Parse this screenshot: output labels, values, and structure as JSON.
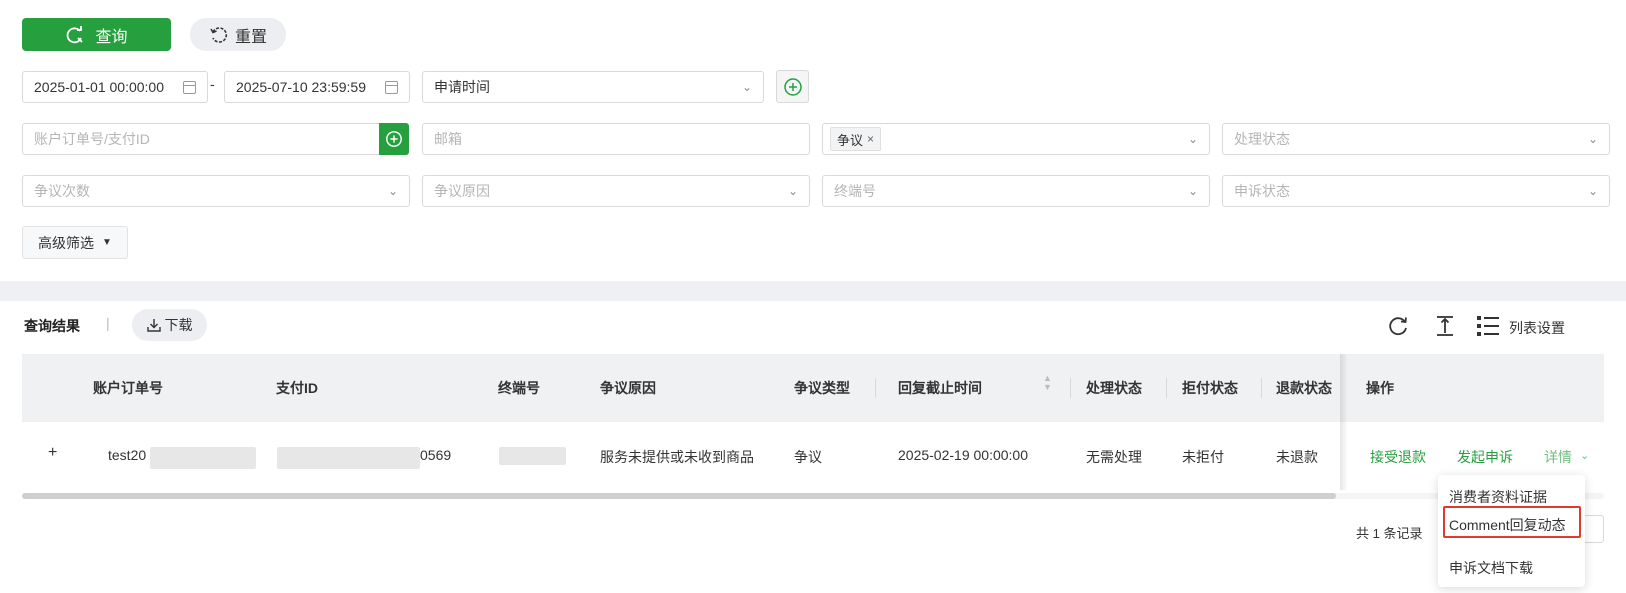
{
  "toolbar": {
    "query_label": "查询",
    "reset_label": "重置"
  },
  "filters": {
    "date_start": "2025-01-01 00:00:00",
    "date_separator": "-",
    "date_end": "2025-07-10 23:59:59",
    "date_type": "申请时间",
    "order_placeholder": "账户订单号/支付ID",
    "email_placeholder": "邮箱",
    "type_tag": "争议",
    "status_placeholder": "处理状态",
    "count_placeholder": "争议次数",
    "reason_placeholder": "争议原因",
    "terminal_placeholder": "终端号",
    "appeal_placeholder": "申诉状态",
    "advanced_label": "高级筛选"
  },
  "results": {
    "title": "查询结果",
    "separator": "|",
    "download_label": "下载",
    "column_settings_label": "列表设置"
  },
  "table": {
    "columns": [
      "账户订单号",
      "支付ID",
      "终端号",
      "争议原因",
      "争议类型",
      "回复截止时间",
      "处理状态",
      "拒付状态",
      "退款状态",
      "操作"
    ],
    "rows": [
      {
        "expand": "+",
        "order_no": "test20",
        "payment_id_suffix": "0569",
        "reason": "服务未提供或未收到商品",
        "type": "争议",
        "deadline": "2025-02-19 00:00:00",
        "process_status": "无需处理",
        "chargeback_status": "未拒付",
        "refund_status": "未退款",
        "actions": [
          "接受退款",
          "发起申诉",
          "详情"
        ]
      }
    ]
  },
  "pagination": {
    "total_text": "共 1 条记录"
  },
  "details_menu": {
    "items": [
      "消费者资料证据",
      "Comment回复动态",
      "申诉文档下载"
    ],
    "highlighted_index": 1
  },
  "colors": {
    "primary": "#26a03e",
    "highlight_border": "#e0392d"
  }
}
